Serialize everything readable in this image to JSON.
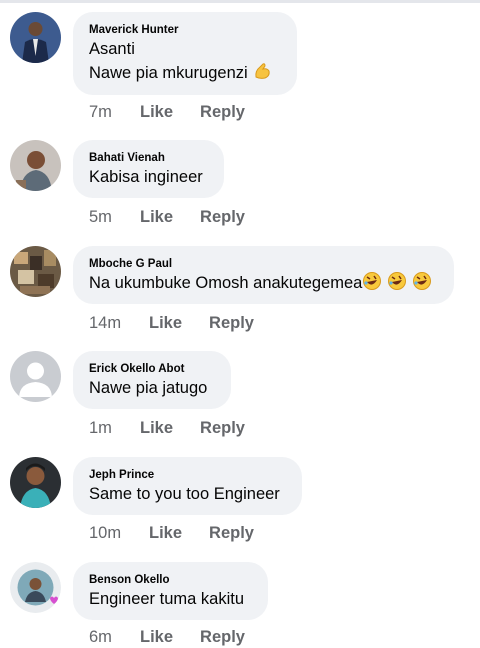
{
  "comments": [
    {
      "author": "Maverick Hunter",
      "lines": [
        "Asanti",
        "Nawe pia mkurugenzi"
      ],
      "emoji": "flexed-biceps",
      "time": "7m"
    },
    {
      "author": "Bahati Vienah",
      "lines": [
        "Kabisa ingineer"
      ],
      "time": "5m"
    },
    {
      "author": "Mboche G Paul",
      "lines": [
        "Na ukumbuke Omosh anakutegemea"
      ],
      "emoji": "rolling-laughing x3",
      "time": "14m"
    },
    {
      "author": "Erick Okello Abot",
      "lines": [
        "Nawe pia jatugo"
      ],
      "time": "1m"
    },
    {
      "author": "Jeph Prince",
      "lines": [
        "Same to you too Engineer"
      ],
      "time": "10m"
    },
    {
      "author": "Benson Okello",
      "lines": [
        "Engineer tuma kakitu"
      ],
      "time": "6m"
    }
  ],
  "actions": {
    "like": "Like",
    "reply": "Reply"
  },
  "colors": {
    "bubble": "#f0f2f5",
    "meta": "#65676b",
    "text": "#050505"
  }
}
